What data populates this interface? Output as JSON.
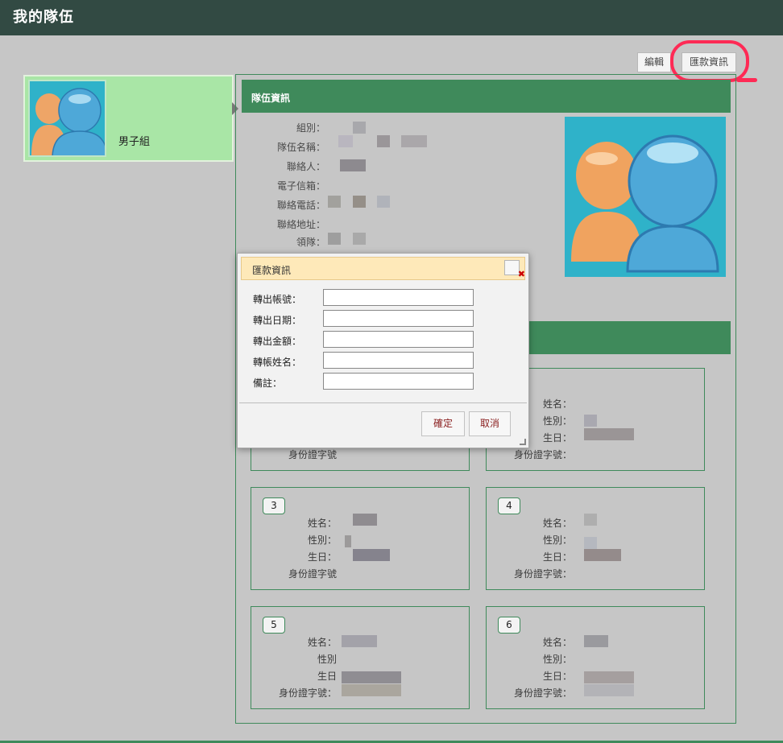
{
  "header": {
    "title": "我的隊伍"
  },
  "toolbar": {
    "edit_label": "編輯",
    "payment_label": "匯款資訊"
  },
  "team": {
    "name": "男子組"
  },
  "info": {
    "heading": "隊伍資訊",
    "fields": [
      "組別：",
      "隊伍名稱：",
      "聯絡人：",
      "電子信箱：",
      "聯絡電話：",
      "聯絡地址：",
      "領隊："
    ]
  },
  "members": {
    "boxes": [
      {
        "number": "",
        "labels": [
          "",
          "",
          "",
          "身份證字號"
        ]
      },
      {
        "number": "",
        "labels": [
          "姓名：",
          "性別：",
          "生日：",
          "身份證字號："
        ]
      },
      {
        "number": "3",
        "labels": [
          "姓名：",
          "性別：",
          "生日：",
          "身份證字號"
        ]
      },
      {
        "number": "4",
        "labels": [
          "姓名：",
          "性別：",
          "生日：",
          "身份證字號："
        ]
      },
      {
        "number": "5",
        "labels": [
          "姓名：",
          "性別",
          "生日",
          "身份證字號："
        ]
      },
      {
        "number": "6",
        "labels": [
          "姓名：",
          "性別：",
          "生日：",
          "身份證字號："
        ]
      }
    ]
  },
  "modal": {
    "title": "匯款資訊",
    "fields": [
      {
        "label": "轉出帳號：",
        "value": ""
      },
      {
        "label": "轉出日期：",
        "value": ""
      },
      {
        "label": "轉出金額：",
        "value": ""
      },
      {
        "label": "轉帳姓名：",
        "value": ""
      },
      {
        "label": "備註：",
        "value": ""
      }
    ],
    "confirm_label": "確定",
    "cancel_label": "取消"
  },
  "colors": {
    "header_bg": "#324a43",
    "accent_green": "#3f8a5b",
    "card_green": "#a9e6a6",
    "modal_header": "#fee9b9",
    "annotation_red": "#ff2a55"
  }
}
